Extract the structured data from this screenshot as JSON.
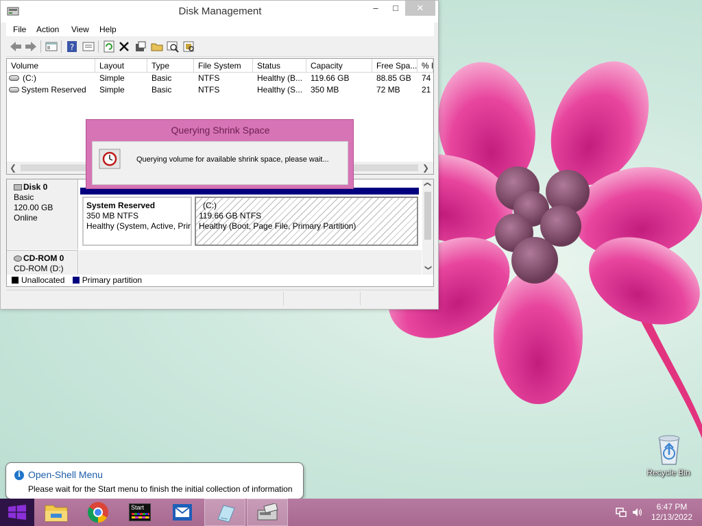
{
  "window": {
    "title": "Disk Management",
    "minimize": "–",
    "maximize": "□",
    "close": "✕"
  },
  "menu": [
    "File",
    "Action",
    "View",
    "Help"
  ],
  "toolbar": {
    "icons": [
      "back-icon",
      "forward-icon",
      "console-tree-icon",
      "help-icon",
      "properties-icon",
      "refresh-icon",
      "delete-icon",
      "settings-icon",
      "open-folder-icon",
      "search-icon",
      "rescan-icon"
    ]
  },
  "volumes": {
    "columns": [
      "Volume",
      "Layout",
      "Type",
      "File System",
      "Status",
      "Capacity",
      "Free Spa...",
      "% F"
    ],
    "rows": [
      [
        "(C:)",
        "Simple",
        "Basic",
        "NTFS",
        "Healthy (B...",
        "119.66 GB",
        "88.85 GB",
        "74"
      ],
      [
        "System Reserved",
        "Simple",
        "Basic",
        "NTFS",
        "Healthy (S...",
        "350 MB",
        "72 MB",
        "21"
      ]
    ]
  },
  "disks": {
    "disk0": {
      "name": "Disk 0",
      "type": "Basic",
      "size": "120.00 GB",
      "status": "Online",
      "partitions": [
        {
          "name": "System Reserved",
          "size": "350 MB NTFS",
          "status": "Healthy (System, Active, Prir"
        },
        {
          "name": "(C:)",
          "size": "119.66 GB NTFS",
          "status": "Healthy (Boot, Page File, Primary Partition)"
        }
      ]
    },
    "cdrom0": {
      "name": "CD-ROM 0",
      "drive": "CD-ROM (D:)"
    }
  },
  "legend": {
    "unallocated": "Unallocated",
    "primary": "Primary partition",
    "unallocated_color": "#000000",
    "primary_color": "#00007f"
  },
  "dialog": {
    "title": "Querying Shrink Space",
    "message": "Querying volume for available shrink space, please wait...",
    "icon": "clock-icon",
    "accent": "#d774b6"
  },
  "notification": {
    "title": "Open-Shell Menu",
    "message": "Please wait for the Start menu to finish the initial collection of information"
  },
  "desktop": {
    "recycle_bin": "Recycle Bin"
  },
  "taskbar": {
    "apps": [
      "file-explorer-icon",
      "chrome-icon",
      "start-app-icon",
      "mail-icon",
      "notepad-icon",
      "disk-management-icon"
    ],
    "start_app_label": "Start",
    "time": "6:47 PM",
    "date": "12/13/2022"
  }
}
